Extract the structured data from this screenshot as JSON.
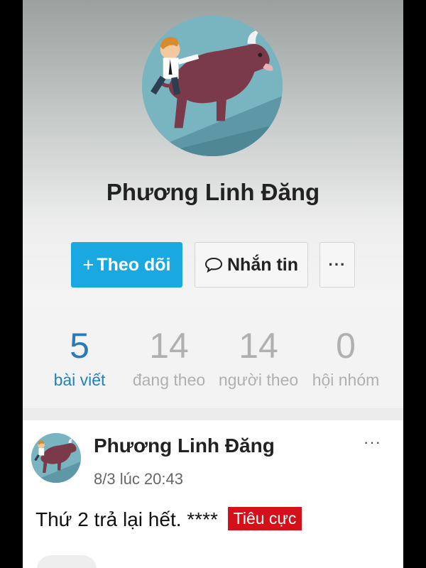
{
  "profile": {
    "name": "Phương Linh Đăng",
    "avatar_icon": "avatar-man-riding-bull"
  },
  "actions": {
    "follow_plus": "+",
    "follow_label": "Theo dõi",
    "message_label": "Nhắn tin",
    "more_label": "···",
    "accent_color": "#1aa8e0"
  },
  "stats": [
    {
      "value": "5",
      "label": "bài viết"
    },
    {
      "value": "14",
      "label": "đang theo"
    },
    {
      "value": "14",
      "label": "người theo"
    },
    {
      "value": "0",
      "label": "hội nhóm"
    }
  ],
  "post": {
    "author": "Phương Linh Đăng",
    "time": "8/3 lúc 20:43",
    "menu": "···",
    "text": "Thứ 2 trả lại hết. ****",
    "tag": "Tiêu cực",
    "tag_color": "#d4101a"
  }
}
